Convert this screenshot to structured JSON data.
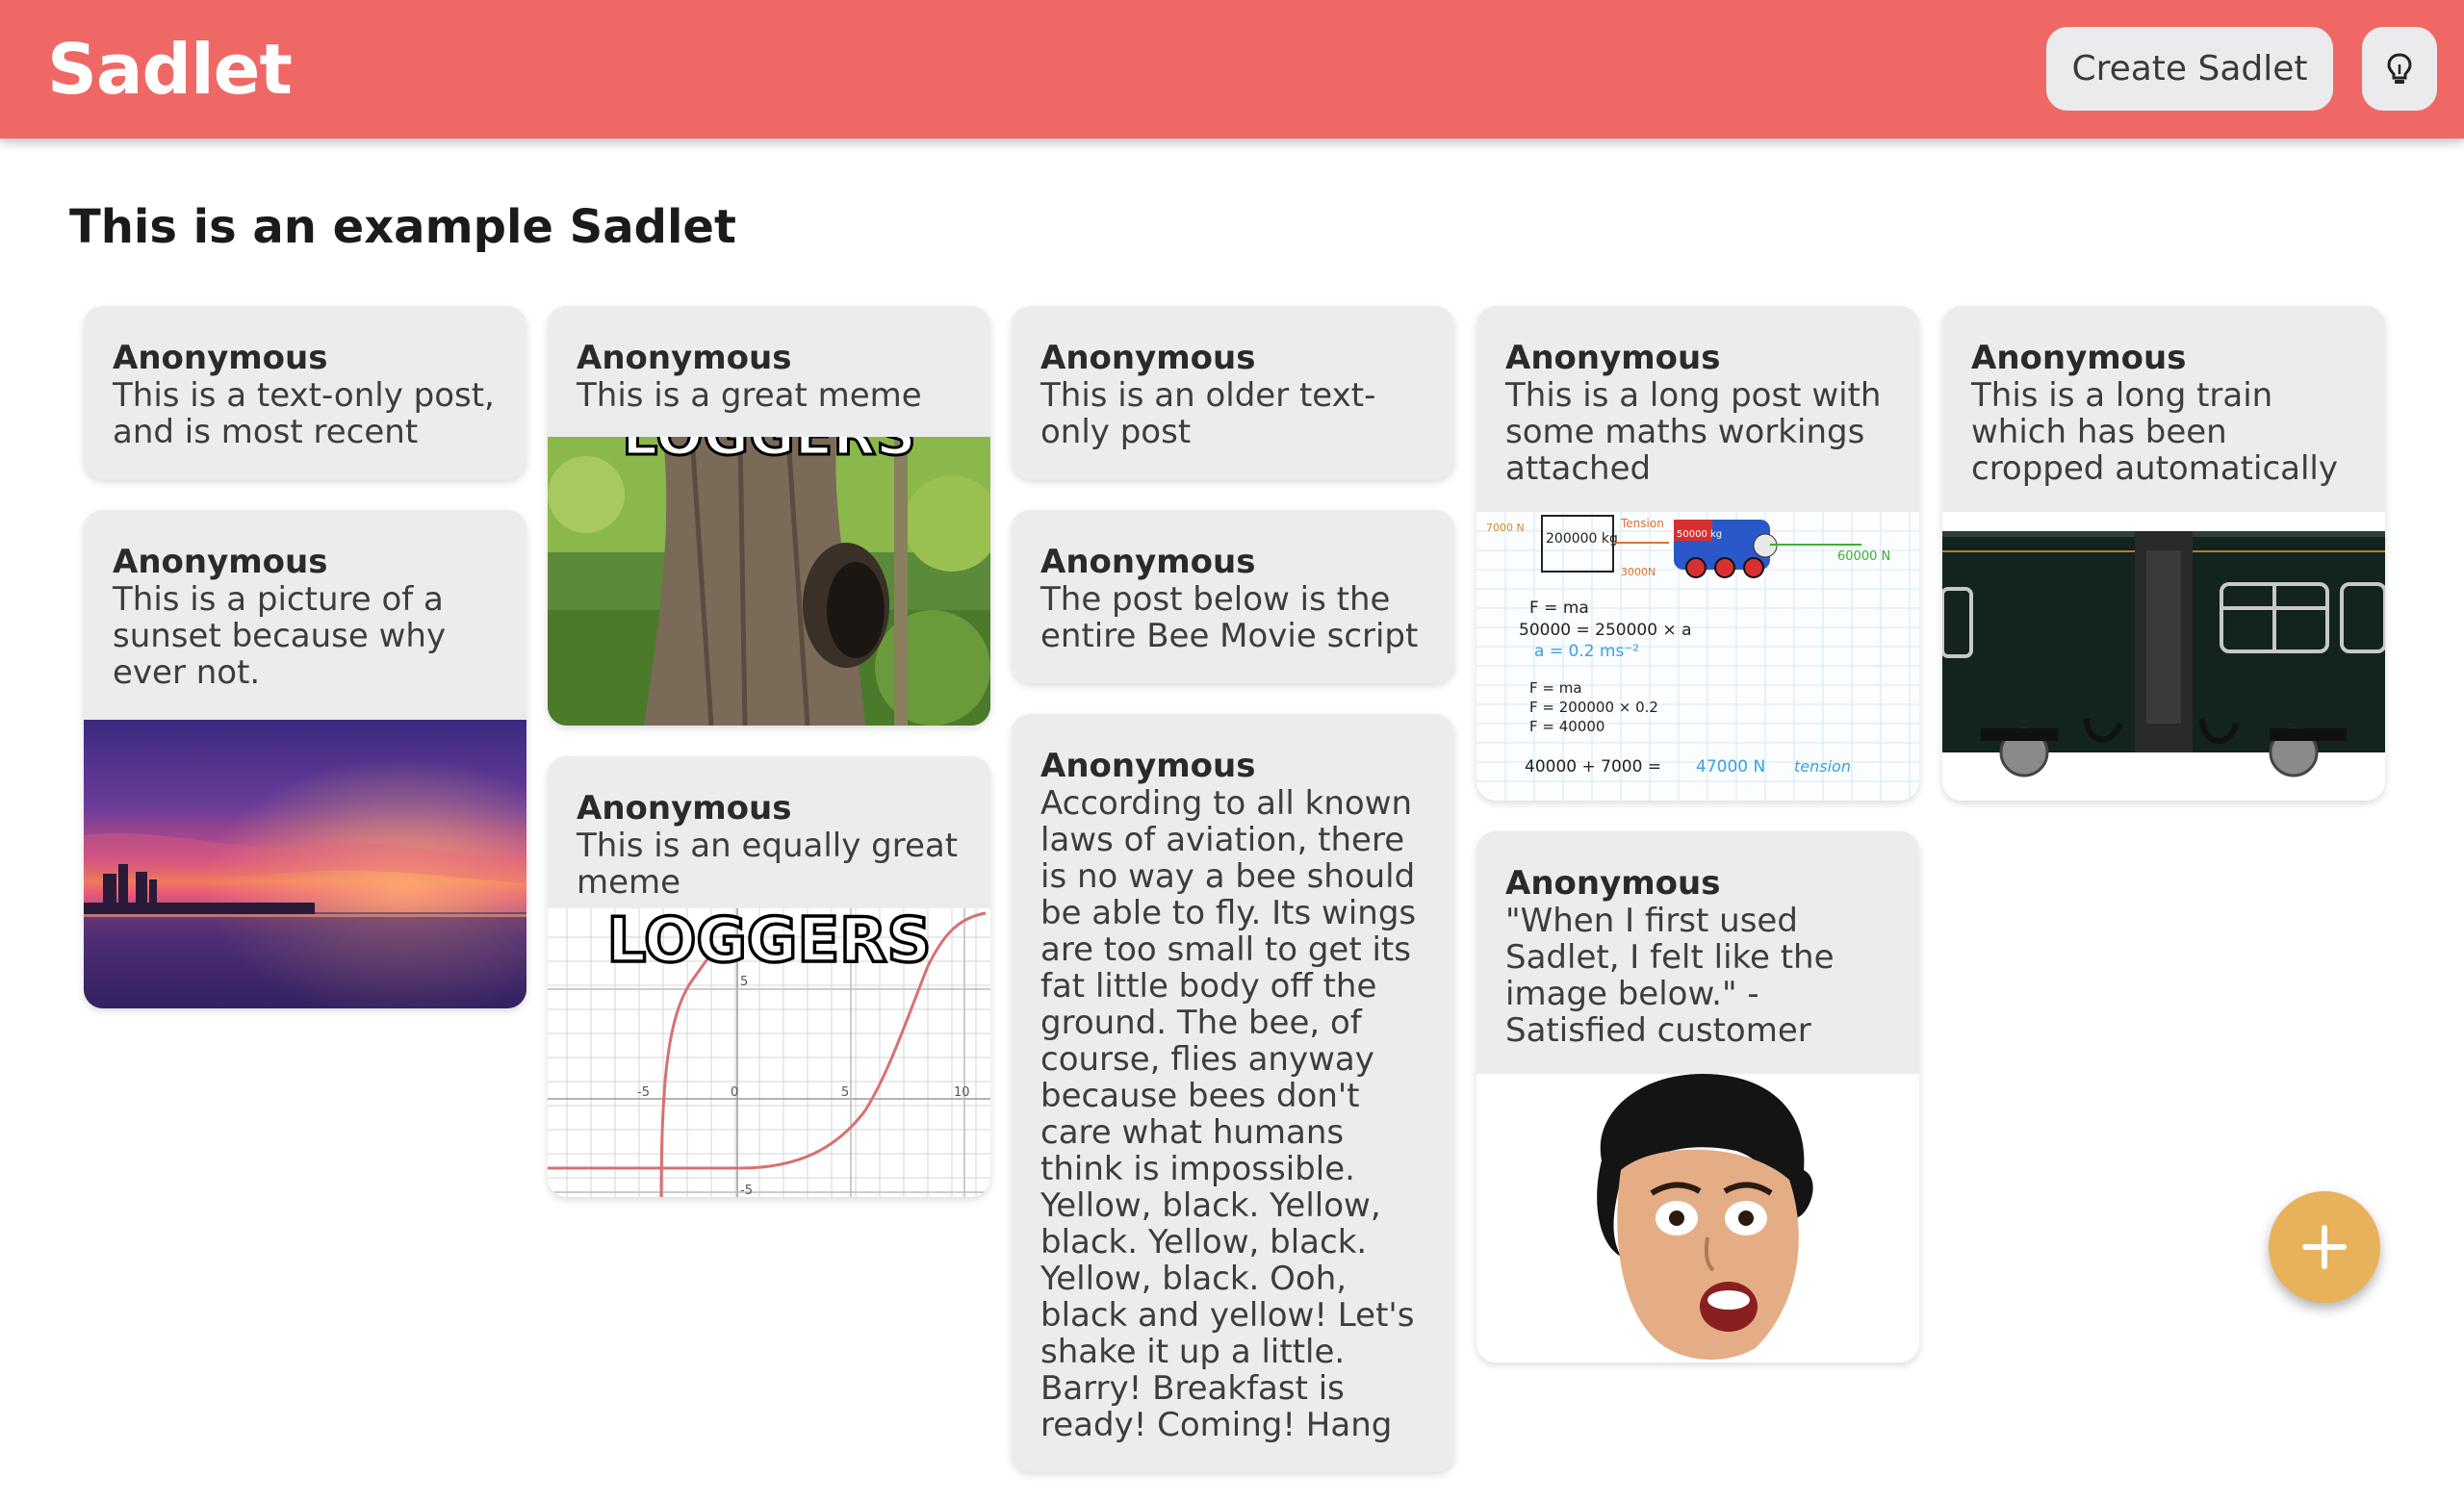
{
  "header": {
    "brand": "Sadlet",
    "create_button": "Create Sadlet",
    "idea_icon": "lightbulb-icon",
    "accent_color": "#f06865"
  },
  "page": {
    "title": "This is an example Sadlet"
  },
  "posts": [
    {
      "author": "Anonymous",
      "text": "This is a text-only post, and is most recent"
    },
    {
      "author": "Anonymous",
      "text": "This is a picture of a sunset because why ever not."
    },
    {
      "author": "Anonymous",
      "text": "This is a great meme",
      "image_caption": "LOGGERS"
    },
    {
      "author": "Anonymous",
      "text": "This is an equally great meme",
      "image_caption": "LOGGERS"
    },
    {
      "author": "Anonymous",
      "text": "This is an older text-only post"
    },
    {
      "author": "Anonymous",
      "text": "The post below is the entire Bee Movie script"
    },
    {
      "author": "Anonymous",
      "text": "According to all known laws of aviation, there is no way a bee should be able to fly. Its wings are too small to get its fat little body off the ground. The bee, of course, flies anyway because bees don't care what humans think is impossible. Yellow, black. Yellow, black. Yellow, black. Yellow, black. Ooh, black and yellow! Let's shake it up a little. Barry! Breakfast is ready! Coming! Hang"
    },
    {
      "author": "Anonymous",
      "text": "This is a long post with some maths workings attached"
    },
    {
      "author": "Anonymous",
      "text": "\"When I first used Sadlet, I felt like the image below.\" - Satisfied customer"
    },
    {
      "author": "Anonymous",
      "text": "This is a long train which has been cropped automatically"
    }
  ],
  "math_image": {
    "tension_label": "Tension",
    "mass_left": "200000 kg",
    "mass_engine": "50000 kg",
    "force_left": "7000 N",
    "force_right": "60000 N",
    "force_mid": "3000N",
    "line1": "F = ma",
    "line2": "50000 = 250000 × a",
    "line3": "a = 0.2 ms⁻²",
    "line4": "F = ma",
    "line5": "F = 200000 × 0.2",
    "line6": "F = 40000",
    "line7": "40000 + 7000 =",
    "result": "47000 N",
    "result_label": "tension"
  },
  "graph_image": {
    "tick_neg": "-5",
    "tick_zero": "0",
    "tick_five": "5",
    "tick_ten": "10",
    "ytick_top": "5",
    "ytick_bottom": "-5"
  },
  "fab": {
    "icon": "plus-icon",
    "color": "#e8b25b"
  }
}
